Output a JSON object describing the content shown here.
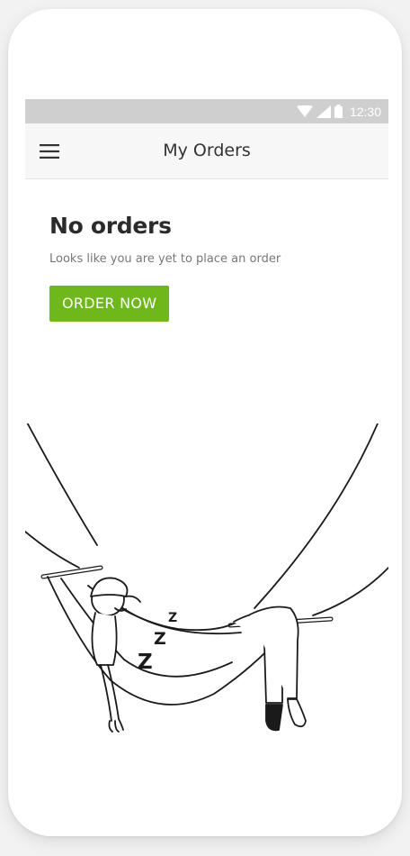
{
  "status_bar": {
    "time": "12:30",
    "icons": [
      "wifi-icon",
      "signal-icon",
      "battery-icon"
    ]
  },
  "app_bar": {
    "title": "My Orders",
    "menu_icon": "hamburger-menu-icon"
  },
  "empty_state": {
    "heading": "No orders",
    "message": "Looks like you are yet to place an order",
    "cta_label": "ORDER NOW",
    "illustration": "person-sleeping-in-hammock",
    "zzz": [
      "Z",
      "Z",
      "Z"
    ]
  },
  "colors": {
    "accent": "#6fb81c",
    "status_bar": "#cfcfcf",
    "app_bar": "#f7f7f7"
  }
}
